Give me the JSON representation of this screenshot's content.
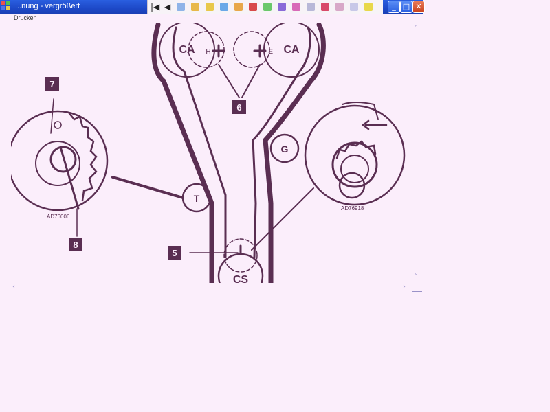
{
  "window": {
    "title": "...nung - vergrößert",
    "controls": {
      "minimize": "_",
      "maximize": "□",
      "close": "✕"
    }
  },
  "toolbar": {
    "nav_first": "first-page",
    "nav_prev": "previous-page",
    "buttons": [
      {
        "name": "zoom-icon",
        "color": "#8fb4e8"
      },
      {
        "name": "palette-icon",
        "color": "#e8b84a"
      },
      {
        "name": "highlighter-icon",
        "color": "#e8c84a"
      },
      {
        "name": "copy-icon",
        "color": "#6aa8e8"
      },
      {
        "name": "print-icon",
        "color": "#e8a84a"
      },
      {
        "name": "face-icon",
        "color": "#d84a4a"
      },
      {
        "name": "note-icon",
        "color": "#6ac86a"
      },
      {
        "name": "image-icon",
        "color": "#8a6ad8"
      },
      {
        "name": "edit-icon",
        "color": "#d86ab8"
      },
      {
        "name": "tool-icon",
        "color": "#b8b8d8"
      },
      {
        "name": "stamp-icon",
        "color": "#d84a6a"
      },
      {
        "name": "person-icon",
        "color": "#d8a8c8"
      },
      {
        "name": "settings-icon",
        "color": "#c8c8e8"
      },
      {
        "name": "flag-icon",
        "color": "#e8d84a"
      }
    ]
  },
  "menu": {
    "drucken": "Drucken"
  },
  "diagram": {
    "pulley_labels": {
      "camshaft_left": "CA",
      "camshaft_right": "CA",
      "mark_h": "H",
      "mark_e": "E",
      "guide": "G",
      "tensioner": "T",
      "crankshaft": "CS"
    },
    "callouts": {
      "c5": "5",
      "c6": "6",
      "c7": "7",
      "c8": "8"
    },
    "figure_codes": {
      "left": "AD76006",
      "right": "AD76918"
    },
    "belt_color": "#5a2e52"
  }
}
